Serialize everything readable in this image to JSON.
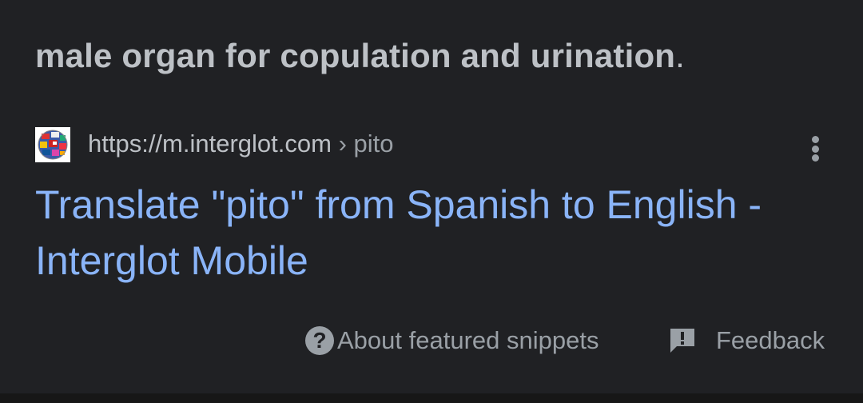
{
  "snippet": {
    "text": "male organ for copulation and urination",
    "end": "."
  },
  "result": {
    "favicon": "globe-flags-icon",
    "url": "https://m.interglot.com",
    "breadcrumb": " › pito",
    "title": "Translate \"pito\" from Spanish to English - Interglot Mobile"
  },
  "footer": {
    "about_icon": "question-circle-icon",
    "about_label": "About featured snippets",
    "feedback_icon": "feedback-icon",
    "feedback_label": "Feedback"
  },
  "colors": {
    "background": "#202124",
    "text": "#bdc1c6",
    "muted": "#9aa0a6",
    "link": "#8ab4f8"
  }
}
